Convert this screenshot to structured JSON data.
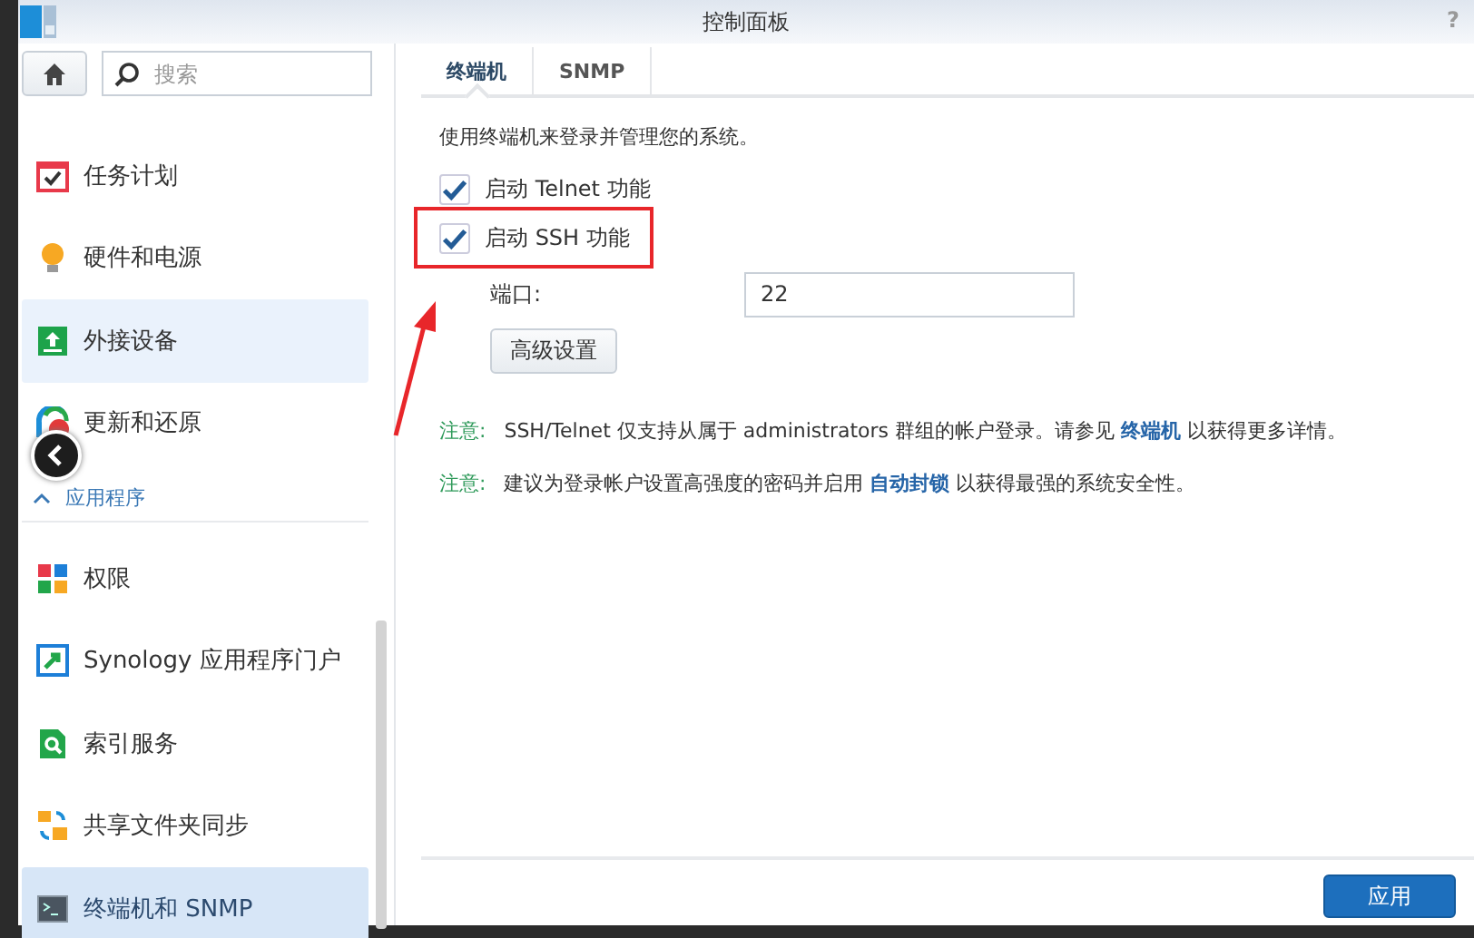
{
  "window": {
    "title": "控制面板",
    "help": "?"
  },
  "search": {
    "placeholder": "搜索"
  },
  "sidebar": {
    "items": [
      {
        "label": "任务计划",
        "kind": "calendar",
        "selected": false,
        "hovered": false
      },
      {
        "label": "硬件和电源",
        "kind": "bulb",
        "selected": false,
        "hovered": false
      },
      {
        "label": "外接设备",
        "kind": "upload",
        "selected": false,
        "hovered": true
      },
      {
        "label": "更新和还原",
        "kind": "sync",
        "selected": false,
        "hovered": false
      }
    ],
    "section": {
      "label": "应用程序",
      "expanded": true
    },
    "section_items": [
      {
        "label": "权限",
        "kind": "grid",
        "selected": false,
        "hovered": false
      },
      {
        "label": "Synology 应用程序门户",
        "kind": "portal",
        "selected": false,
        "hovered": false
      },
      {
        "label": "索引服务",
        "kind": "index",
        "selected": false,
        "hovered": false
      },
      {
        "label": "共享文件夹同步",
        "kind": "folders",
        "selected": false,
        "hovered": false
      },
      {
        "label": "终端机和 SNMP",
        "kind": "terminal",
        "selected": true,
        "hovered": false
      }
    ]
  },
  "tabs": [
    {
      "label": "终端机",
      "selected": true
    },
    {
      "label": "SNMP",
      "selected": false
    }
  ],
  "description": "使用终端机来登录并管理您的系统。",
  "options": [
    {
      "label": "启动 Telnet 功能",
      "checked": true,
      "annotated": false
    },
    {
      "label": "启动 SSH 功能",
      "checked": true,
      "annotated": true
    }
  ],
  "port": {
    "label": "端口:",
    "value": "22"
  },
  "advanced_button": "高级设置",
  "notes": [
    {
      "label": "注意:",
      "text": "SSH/Telnet 仅支持从属于 administrators 群组的帐户登录。请参见 ",
      "link": "终端机",
      "after": " 以获得更多详情。"
    },
    {
      "label": "注意:",
      "text": "建议为登录帐户设置高强度的密码并启用 ",
      "link": "自动封锁",
      "after": " 以获得最强的系统安全性。"
    }
  ],
  "apply_button": "应用"
}
